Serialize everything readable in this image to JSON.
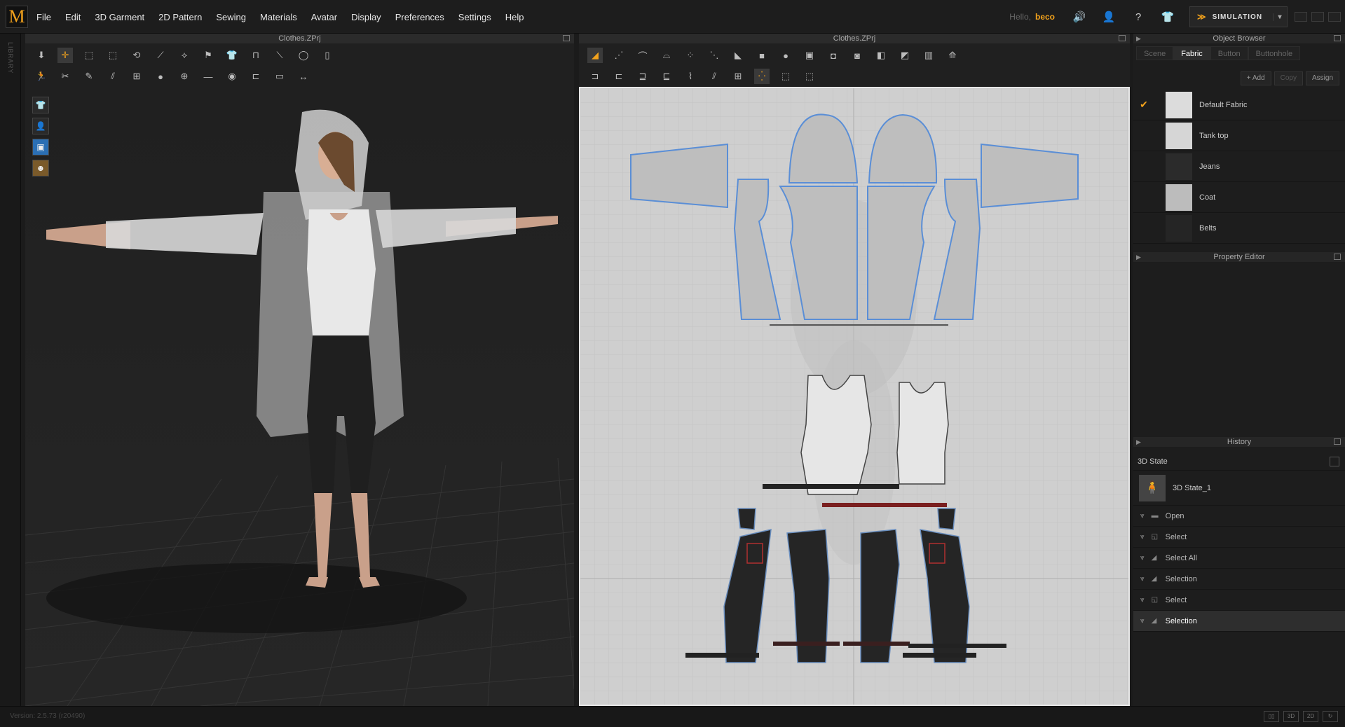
{
  "menubar": {
    "logo": "M",
    "items": [
      "File",
      "Edit",
      "3D Garment",
      "2D Pattern",
      "Sewing",
      "Materials",
      "Avatar",
      "Display",
      "Preferences",
      "Settings",
      "Help"
    ],
    "hello": "Hello,",
    "username": "beco",
    "simulation_label": "SIMULATION"
  },
  "sidebar": {
    "library_label": "LIBRARY"
  },
  "pane3d": {
    "title": "Clothes.ZPrj"
  },
  "pane2d": {
    "title": "Clothes.ZPrj"
  },
  "object_browser": {
    "title": "Object Browser",
    "tabs": [
      "Scene",
      "Fabric",
      "Button",
      "Buttonhole"
    ],
    "active_tab": "Fabric",
    "buttons": {
      "add": "Add",
      "copy": "Copy",
      "assign": "Assign"
    },
    "fabrics": [
      {
        "name": "Default Fabric",
        "swatch": "#dcdcdc",
        "checked": true
      },
      {
        "name": "Tank top",
        "swatch": "#d6d6d6",
        "checked": false
      },
      {
        "name": "Jeans",
        "swatch": "#2b2b2b",
        "checked": false
      },
      {
        "name": "Coat",
        "swatch": "#bcbcbc",
        "checked": false
      },
      {
        "name": "Belts",
        "swatch": "#252525",
        "checked": false
      }
    ]
  },
  "property_editor": {
    "title": "Property Editor"
  },
  "history": {
    "title": "History",
    "state_header": "3D State",
    "state_name": "3D State_1",
    "entries": [
      "Open",
      "Select",
      "Select All",
      "Selection",
      "Select",
      "Selection"
    ]
  },
  "status": {
    "version": "Version: 2.5.73   (r20490)"
  },
  "colors": {
    "accent": "#f2a21c",
    "pattern_outline": "#5a8ed6",
    "seam_red": "#b03030"
  }
}
